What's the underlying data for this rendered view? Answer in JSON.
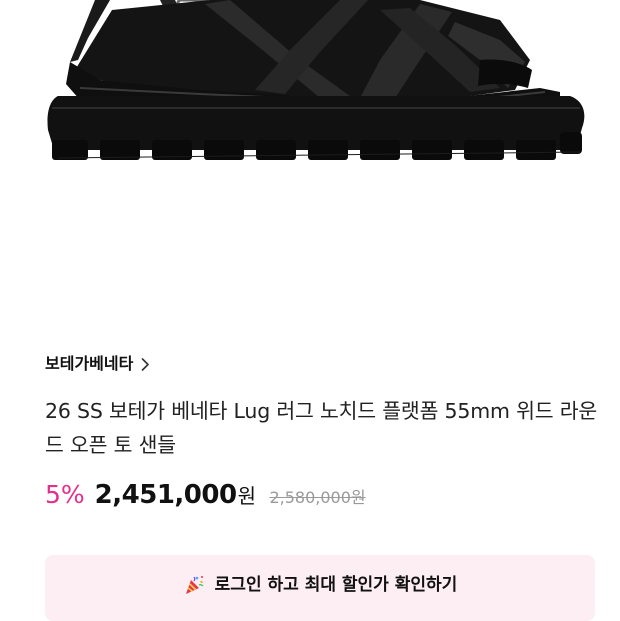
{
  "product_image": {
    "alt": "",
    "icon": "sandal-product-photo"
  },
  "brand": {
    "name": "보테가베네타",
    "chevron_icon": "chevron-right-icon"
  },
  "product": {
    "title": "26 SS 보테가 베네타 Lug 러그 노치드 플랫폼 55mm 위드 라운드 오픈 토 샌들"
  },
  "pricing": {
    "discount": "5%",
    "price": "2,451,000",
    "currency": "원",
    "original_price": "2,580,000원",
    "discount_color": "#e62e8a"
  },
  "login_banner": {
    "label": "로그인 하고 최대 할인가 확인하기",
    "icon": "party-popper-icon",
    "background": "#fdeef3"
  }
}
